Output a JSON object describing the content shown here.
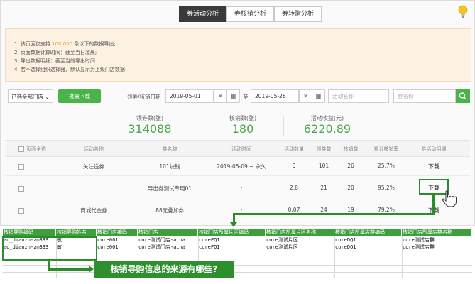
{
  "tabs": [
    "券活动分析",
    "券核销分析",
    "券转赠分析"
  ],
  "notes": {
    "n1_pre": "1. 该页面仅支持",
    "n1_num": "100,000",
    "n1_post": "条以下的数据导出;",
    "n2": "2. 页面数据计算时间：截至当日凌晨;",
    "n3": "3. 导出数据明细：截至当前导出时间",
    "n4": "4. 若不选择组织选择器，默认显示为上级门店数据"
  },
  "filters": {
    "store_select": "已选全部门店",
    "download_btn": "批量下载",
    "date_label": "领券/核销日期",
    "date_start": "2019-05-01",
    "date_to": "至",
    "date_end": "2019-05-26",
    "activity_placeholder": "活动名称",
    "coupon_placeholder": "券名称"
  },
  "stats": [
    {
      "title": "领券数(张)",
      "value": "314088"
    },
    {
      "title": "核销数(张)",
      "value": "180"
    },
    {
      "title": "活动收益(元)",
      "value": "6220.89"
    }
  ],
  "table": {
    "headers": [
      "页面全选",
      "活动名称",
      "券名称",
      "活动时间",
      "活动数量",
      "领券数",
      "核销数",
      "累计核销率",
      "券活动明细"
    ],
    "rows": [
      {
        "activity": "关注送券",
        "coupon": "101块钱",
        "time": "2019-05-09 ~ 永久",
        "qty": "0",
        "received": "101",
        "verified": "26",
        "rate": "25.7%",
        "action": "下载"
      },
      {
        "activity": "",
        "coupon": "导出券测试专用01",
        "time": "-",
        "qty": "2.8",
        "received": "21",
        "verified": "20",
        "rate": "95.2%",
        "action": "下载"
      },
      {
        "activity": "商城代金券",
        "coupon": "88元叠加券",
        "time": "-",
        "qty": "0.07",
        "received": "24",
        "verified": "19",
        "rate": "79.2%",
        "action": "下载"
      }
    ]
  },
  "sheet": {
    "headers": [
      "核销导购编码",
      "核销导购姓名",
      "核销门店编码",
      "核销门店",
      "核销门店所属片区编码",
      "核销门店所属片区名称",
      "核销门店所属店群编码",
      "核销门店所属店群名称"
    ],
    "rows": [
      [
        "ad_dianzh-zm333",
        "敏",
        "core001",
        "core测试门店-aina",
        "coreFQ1",
        "core测试片区",
        "coreDQ1",
        "core测试店群"
      ],
      [
        "ad_dianzh-zm333",
        "敏",
        "core001",
        "core测试门店-aina",
        "coreFQ1",
        "core测试片区",
        "coreDQ1",
        "core测试店群"
      ]
    ]
  },
  "question": "核销导购信息的来源有哪些?",
  "colors": {
    "accent": "#4ab44a",
    "annotation": "#2c8c2c",
    "note_bg": "#fdf1e2"
  }
}
